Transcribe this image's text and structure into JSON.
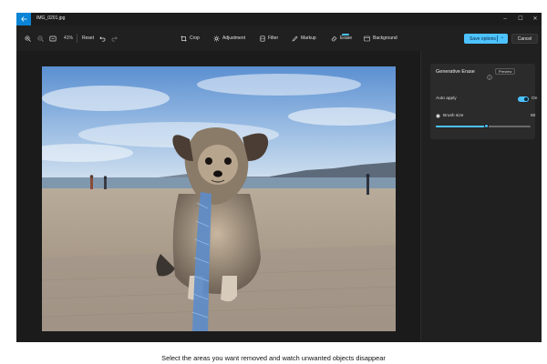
{
  "window": {
    "filename": "IMG_0201.jpg",
    "controls": [
      "–",
      "☐",
      "✕"
    ]
  },
  "toolbar": {
    "zoom_level": "41%",
    "reset_label": "Reset",
    "tools": [
      {
        "label": "Crop",
        "icon": "crop-icon"
      },
      {
        "label": "Adjustment",
        "icon": "adjustment-icon"
      },
      {
        "label": "Filter",
        "icon": "filter-icon"
      },
      {
        "label": "Markup",
        "icon": "markup-icon"
      },
      {
        "label": "Erase",
        "icon": "erase-icon",
        "active": true
      },
      {
        "label": "Background",
        "icon": "background-icon"
      }
    ],
    "save_label": "Save options",
    "cancel_label": "Cancel"
  },
  "panel": {
    "title": "Generative Erase",
    "badge": "Preview",
    "auto_apply_label": "Auto apply",
    "auto_apply_state": "On",
    "brush_size_label": "Brush size",
    "brush_size_value": "60",
    "brush_fraction": 0.53
  },
  "caption": "Select the areas you want removed and watch unwanted objects disappear",
  "colors": {
    "accent": "#4cc2ff",
    "window_bg": "#202020",
    "titlebar_accent": "#0a84d6"
  }
}
